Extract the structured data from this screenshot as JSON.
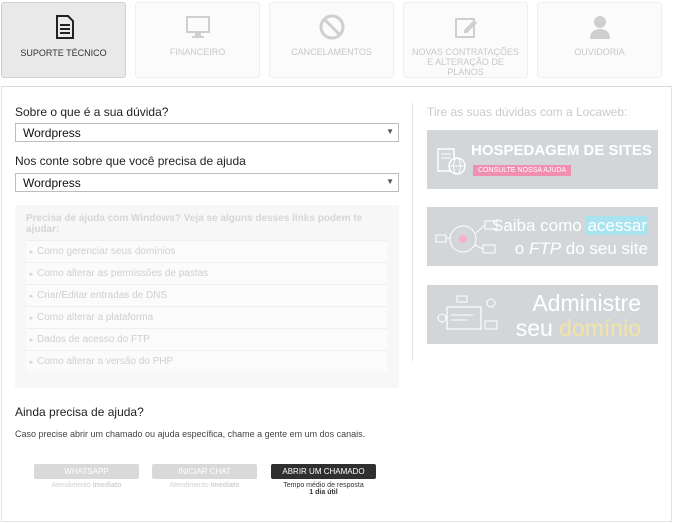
{
  "tabs": [
    {
      "label": "SUPORTE TÉCNICO",
      "icon": "document-icon",
      "active": true
    },
    {
      "label": "FINANCEIRO",
      "icon": "monitor-icon",
      "active": false
    },
    {
      "label": "CANCELAMENTOS",
      "icon": "cancel-icon",
      "active": false
    },
    {
      "label": "NOVAS CONTRATAÇÕES E ALTERAÇÃO DE PLANOS",
      "icon": "edit-icon",
      "active": false
    },
    {
      "label": "OUVIDORIA",
      "icon": "user-icon",
      "active": false
    }
  ],
  "form": {
    "question1": "Sobre o que é a sua dúvida?",
    "select1_value": "Wordpress",
    "question2": "Nos conte sobre que você precisa de ajuda",
    "select2_value": "Wordpress"
  },
  "help": {
    "intro": "Precisa de ajuda com Windows? Veja se alguns desses links podem te ajudar:",
    "links": [
      "Como gerenciar seus domínios",
      "Como alterar as permissões de pastas",
      "Criar/Editar entradas de DNS",
      "Como alterar a plataforma",
      "Dados de acesso do FTP",
      "Como alterar a versão do PHP"
    ]
  },
  "right": {
    "title": "Tire as suas dúvidas com a Locaweb:",
    "banner1": {
      "title": "HOSPEDAGEM DE SITES",
      "cta": "CONSULTE NOSSA AJUDA"
    },
    "banner2": {
      "line1_pre": "Saiba como ",
      "line1_hl": "acessar",
      "line2_pre": "o ",
      "line2_it": "FTP",
      "line2_post": " do seu site"
    },
    "banner3": {
      "line1": "Administre",
      "line2_pre": "seu ",
      "line2_hl": "domínio"
    }
  },
  "support": {
    "title": "Ainda precisa de ajuda?",
    "subtitle": "Caso precise abrir um chamado ou ajuda específica, chame a gente em um dos canais.",
    "buttons": [
      {
        "label": "WHATSAPP",
        "note_pre": "Atendimento ",
        "note_bold": "Imediato"
      },
      {
        "label": "INICIAR CHAT",
        "note_pre": "Atendimento ",
        "note_bold": "Imediato"
      },
      {
        "label": "ABRIR UM CHAMADO",
        "note_pre": "Tempo médio de resposta",
        "note_bold": "1 dia útil"
      }
    ]
  }
}
